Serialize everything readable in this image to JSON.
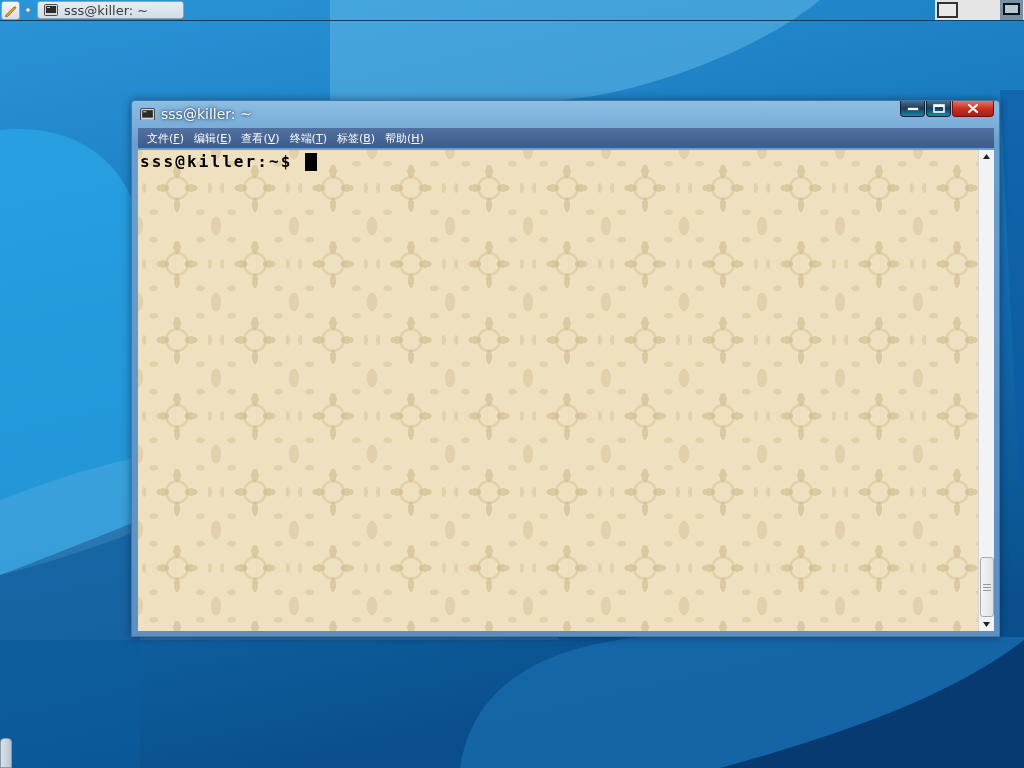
{
  "top_panel": {
    "taskbar_items": [
      {
        "title": "sss@killer: ~"
      }
    ],
    "workspaces": [
      {
        "selected": false
      },
      {
        "selected": true
      }
    ]
  },
  "window": {
    "title": "sss@killer: ~",
    "menu": [
      {
        "label": "文件(",
        "mnemonic": "F",
        "suffix": ")"
      },
      {
        "label": "编辑(",
        "mnemonic": "E",
        "suffix": ")"
      },
      {
        "label": "查看(",
        "mnemonic": "V",
        "suffix": ")"
      },
      {
        "label": "终端(",
        "mnemonic": "T",
        "suffix": ")"
      },
      {
        "label": "标签(",
        "mnemonic": "B",
        "suffix": ")"
      },
      {
        "label": "帮助(",
        "mnemonic": "H",
        "suffix": ")"
      }
    ],
    "terminal": {
      "prompt": "sss@killer:~$"
    }
  }
}
